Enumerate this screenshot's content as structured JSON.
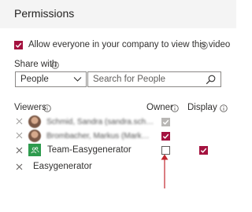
{
  "header": {
    "title": "Permissions"
  },
  "allow_everyone": {
    "label": "Allow everyone in your company to view this video",
    "checked": true
  },
  "share_with": {
    "label": "Share with",
    "dropdown_value": "People",
    "search_placeholder": "Search for People"
  },
  "columns": {
    "viewers": "Viewers",
    "owner": "Owner",
    "display": "Display"
  },
  "viewers": [
    {
      "name": "Schmid, Sandra (sandra.sch…",
      "owner": true,
      "owner_disabled": true,
      "display": false,
      "avatar": "person",
      "blurred": true
    },
    {
      "name": "Brombacher, Markus (Mark…",
      "owner": true,
      "owner_disabled": false,
      "display": false,
      "avatar": "person",
      "blurred": true
    },
    {
      "name": "Team-Easygenerator",
      "owner": false,
      "owner_disabled": false,
      "display": true,
      "avatar": "group",
      "blurred": false
    },
    {
      "name": "Easygenerator",
      "owner": false,
      "owner_disabled": false,
      "display": false,
      "avatar": "none",
      "blurred": false
    }
  ],
  "colors": {
    "accent": "#a4123f",
    "header_bg": "#f4f4f4",
    "arrow": "#c0262d"
  }
}
